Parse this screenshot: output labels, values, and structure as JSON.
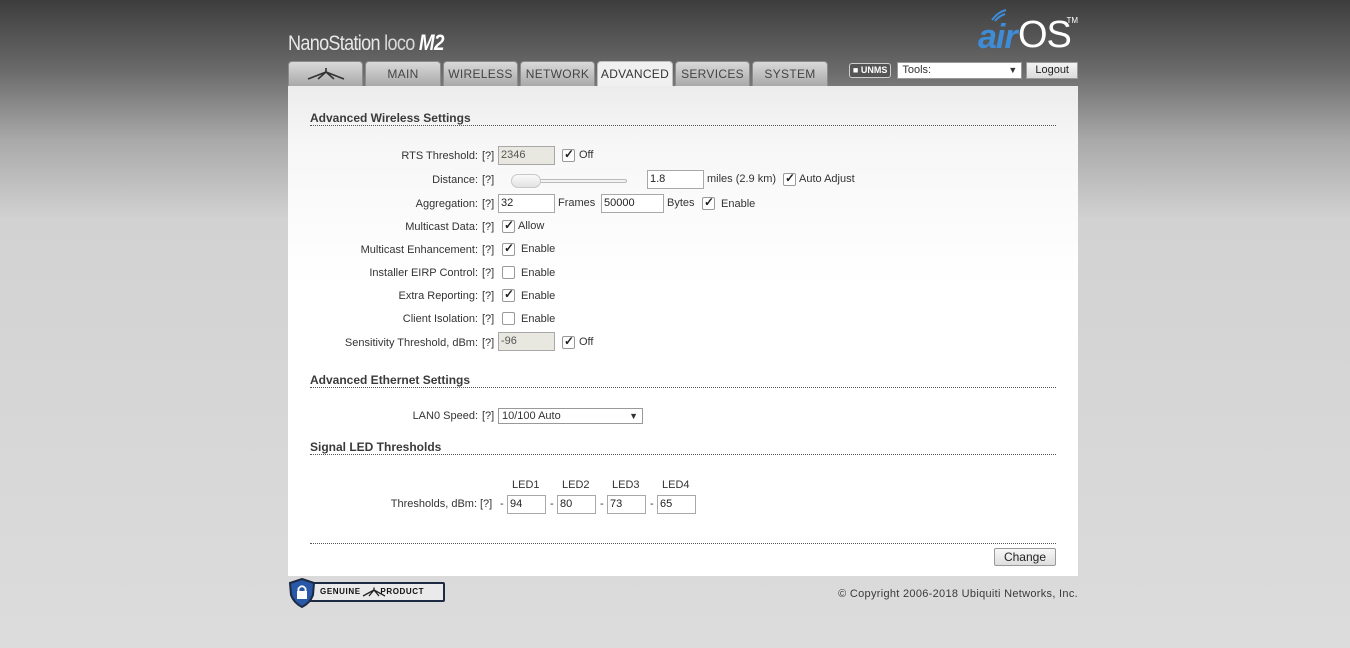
{
  "header": {
    "product_main": "NanoStation",
    "product_thin": "loco",
    "product_model": "M2",
    "logo_air": "air",
    "logo_os": "OS",
    "logo_tm": "TM"
  },
  "tabs": [
    {
      "label": ""
    },
    {
      "label": "MAIN"
    },
    {
      "label": "WIRELESS"
    },
    {
      "label": "NETWORK"
    },
    {
      "label": "ADVANCED"
    },
    {
      "label": "SERVICES"
    },
    {
      "label": "SYSTEM"
    }
  ],
  "toolbar": {
    "unms": "UNMS",
    "tools_value": "Tools:",
    "logout": "Logout"
  },
  "wireless": {
    "title": "Advanced Wireless Settings",
    "help": "[?]",
    "rts": {
      "label": "RTS Threshold:",
      "value": "2346",
      "off_label": "Off"
    },
    "distance": {
      "label": "Distance:",
      "value": "1.8",
      "unit": "miles (2.9 km)",
      "auto_label": "Auto Adjust"
    },
    "aggregation": {
      "label": "Aggregation:",
      "frames": "32",
      "frames_label": "Frames",
      "bytes": "50000",
      "bytes_label": "Bytes",
      "enable_label": "Enable"
    },
    "multicast_data": {
      "label": "Multicast Data:",
      "option": "Allow"
    },
    "multicast_enh": {
      "label": "Multicast Enhancement:",
      "option": "Enable"
    },
    "eirp": {
      "label": "Installer EIRP Control:",
      "option": "Enable"
    },
    "extra_reporting": {
      "label": "Extra Reporting:",
      "option": "Enable"
    },
    "client_isolation": {
      "label": "Client Isolation:",
      "option": "Enable"
    },
    "sensitivity": {
      "label": "Sensitivity Threshold, dBm:",
      "value": "-96",
      "off_label": "Off"
    }
  },
  "ethernet": {
    "title": "Advanced Ethernet Settings",
    "lan0": {
      "label": "LAN0 Speed:",
      "value": "10/100 Auto"
    }
  },
  "led": {
    "title": "Signal LED Thresholds",
    "headers": [
      "LED1",
      "LED2",
      "LED3",
      "LED4"
    ],
    "label": "Thresholds, dBm:",
    "dash": "-",
    "values": [
      "94",
      "80",
      "73",
      "65"
    ]
  },
  "actions": {
    "change": "Change"
  },
  "footer": {
    "badge": "GENUINE       PRODUCT",
    "copyright": "© Copyright 2006-2018 Ubiquiti Networks, Inc."
  }
}
